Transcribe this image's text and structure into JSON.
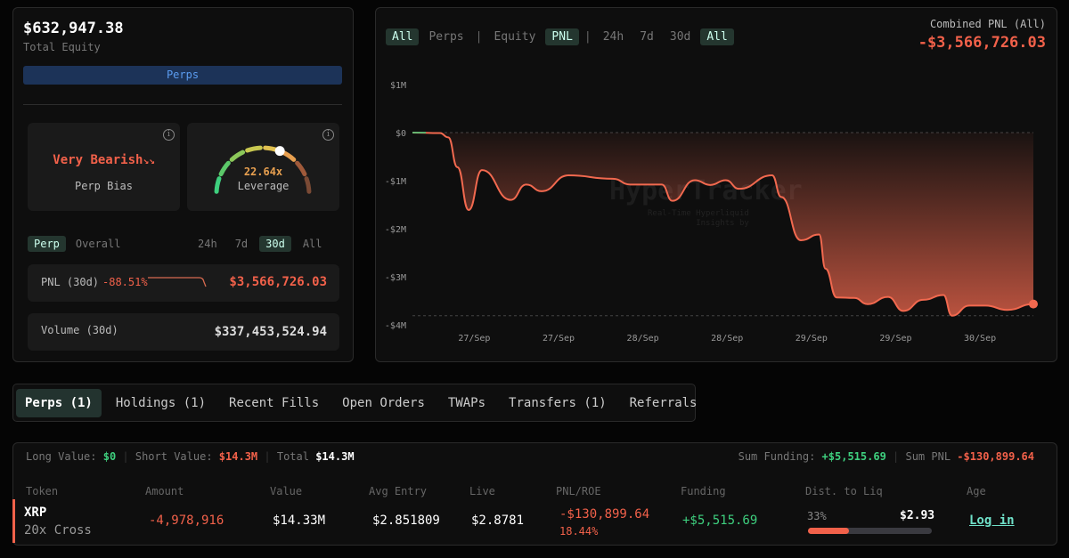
{
  "summary": {
    "equity": "$632,947.38",
    "equity_label": "Total Equity",
    "perps_bar": "Perps"
  },
  "bias": {
    "label": "Very Bearish",
    "arrows": "↘↘",
    "caption": "Perp Bias"
  },
  "leverage": {
    "value": "22.64x",
    "caption": "Leverage",
    "gauge_fraction": 0.62
  },
  "stats_tabs": {
    "types": [
      "Perp",
      "Overall"
    ],
    "active_type": "Perp",
    "ranges": [
      "24h",
      "7d",
      "30d",
      "All"
    ],
    "active_range": "30d"
  },
  "pnl_row": {
    "label": "PNL (30d)",
    "pct": "-88.51%",
    "value": "$3,566,726.03"
  },
  "volume_row": {
    "label": "Volume (30d)",
    "value": "$337,453,524.94"
  },
  "chart_header": {
    "filters": [
      "All",
      "Perps",
      "|",
      "Equity",
      "PNL",
      "|",
      "24h",
      "7d",
      "30d",
      "All"
    ],
    "active": [
      0,
      4,
      9
    ],
    "combined_label": "Combined PNL (All)",
    "combined_value": "-$3,566,726.03",
    "watermark": "HyperTracker",
    "watermark_sub1": "Real-Time Hyperliquid",
    "watermark_sub2": "Insights by"
  },
  "chart_data": {
    "type": "area",
    "title": "Combined PNL (All)",
    "ylabel": "",
    "xlabel": "",
    "ylim": [
      -4,
      1
    ],
    "yticks": [
      1,
      0,
      -1,
      -2,
      -3,
      -4
    ],
    "ytick_labels": [
      "$1M",
      "$0",
      "-$1M",
      "-$2M",
      "-$3M",
      "-$4M"
    ],
    "xlim": [
      -8.8,
      79.6
    ],
    "xticks": [
      0,
      12,
      24,
      36,
      48,
      60,
      72
    ],
    "xtick_labels": [
      "27/Sep",
      "27/Sep",
      "28/Sep",
      "28/Sep",
      "29/Sep",
      "29/Sep",
      "30/Sep"
    ],
    "x_unit": "hours",
    "y_unit": "$M",
    "x": [
      -8.8,
      -4.9,
      -3.7,
      -2.4,
      -0.8,
      1.1,
      5.2,
      7.4,
      9.6,
      13.4,
      19.7,
      22.2,
      26.7,
      28.2,
      31.4,
      33.6,
      35.8,
      37.7,
      42.4,
      43.7,
      46.5,
      49.1,
      50.0,
      51.6,
      54.1,
      56.0,
      58.9,
      61.1,
      63.9,
      66.8,
      68.0,
      70.5,
      72.8,
      75.9,
      79.6
    ],
    "y": [
      0,
      -0.01,
      -0.1,
      -0.72,
      -1.61,
      -0.78,
      -1.4,
      -1.08,
      -1.22,
      -0.89,
      -0.96,
      -1.08,
      -1.08,
      -1.42,
      -0.99,
      -1.09,
      -0.99,
      -1.17,
      -0.89,
      -1.34,
      -2.24,
      -2.12,
      -2.83,
      -3.43,
      -3.44,
      -3.57,
      -3.42,
      -3.71,
      -3.48,
      -3.38,
      -3.81,
      -3.6,
      -3.6,
      -3.69,
      -3.567
    ],
    "reference_lines": [
      0,
      -3.81
    ],
    "color": "#f2694f"
  },
  "tabs": [
    {
      "label": "Perps (1)",
      "active": true
    },
    {
      "label": "Holdings (1)"
    },
    {
      "label": "Recent Fills"
    },
    {
      "label": "Open Orders"
    },
    {
      "label": "TWAPs"
    },
    {
      "label": "Transfers (1)"
    },
    {
      "label": "Referrals"
    }
  ],
  "positions": {
    "long_label": "Long Value:",
    "long_value": "$0",
    "short_label": "Short Value:",
    "short_value": "$14.3M",
    "total_label": "Total",
    "total_value": "$14.3M",
    "funding_label": "Sum Funding:",
    "funding_value": "+$5,515.69",
    "sum_pnl_label": "Sum PNL",
    "sum_pnl_value": "-$130,899.64",
    "columns": [
      "Token",
      "Amount",
      "Value",
      "Avg Entry",
      "Live",
      "PNL/ROE",
      "Funding",
      "Dist. to Liq",
      "Age"
    ],
    "rows": [
      {
        "token": "XRP",
        "mode": "20x Cross",
        "amount": "-4,978,916",
        "value": "$14.33M",
        "avg_entry": "$2.851809",
        "live": "$2.8781",
        "pnl": "-$130,899.64",
        "roe": "18.44%",
        "funding": "+$5,515.69",
        "liq_pct": "33%",
        "liq_fraction": 0.33,
        "liq_price": "$2.93",
        "age": "Log in"
      }
    ]
  }
}
